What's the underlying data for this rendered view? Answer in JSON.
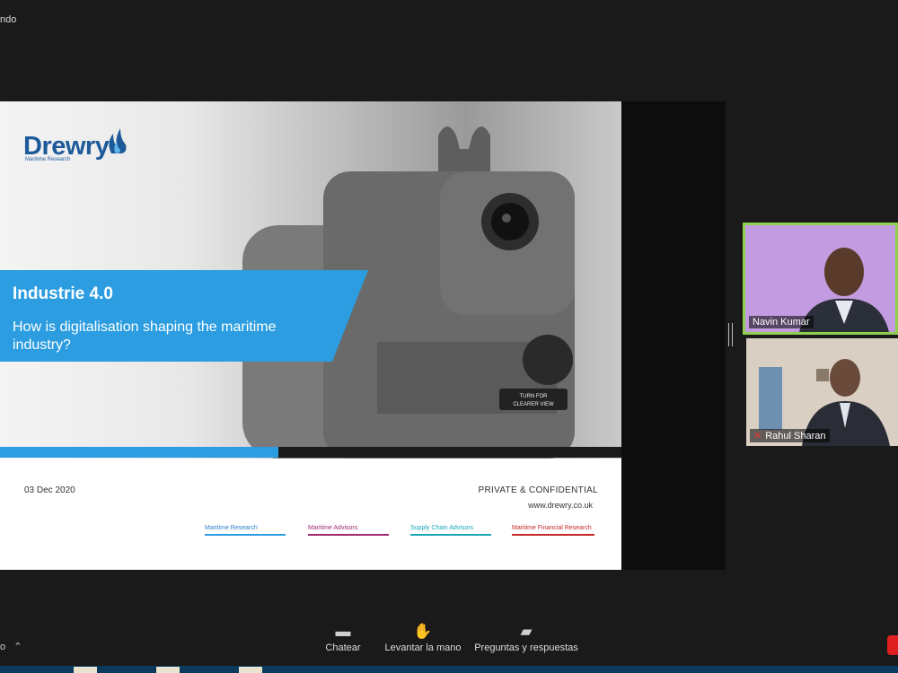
{
  "top_label": "ndo",
  "slide": {
    "logo": {
      "name": "Drewry",
      "subtitle": "Maritime Research"
    },
    "title": "Industrie 4.0",
    "subtitle": "How is digitalisation shaping the maritime industry?",
    "device_label_1": "TURN FOR",
    "device_label_2": "CLEARER VIEW",
    "date": "03 Dec 2020",
    "confidential": "PRIVATE & CONFIDENTIAL",
    "website": "www.drewry.co.uk",
    "tags": [
      "Maritime Research",
      "Maritime Advisors",
      "Supply Chain Advisors",
      "Maritime Financial Research"
    ],
    "colors": {
      "brand_blue": "#1e5a9a",
      "banner_blue": "#2b9de0"
    }
  },
  "participants": [
    {
      "name": "Navin Kumar",
      "active_speaker": true
    },
    {
      "name": "Rahul Sharan",
      "muted": true
    }
  ],
  "toolbar": {
    "left_label": "o",
    "buttons": [
      {
        "label": "Chatear",
        "icon": "chat-icon"
      },
      {
        "label": "Levantar la mano",
        "icon": "hand-icon"
      },
      {
        "label": "Preguntas y respuestas",
        "icon": "qa-icon"
      }
    ]
  }
}
